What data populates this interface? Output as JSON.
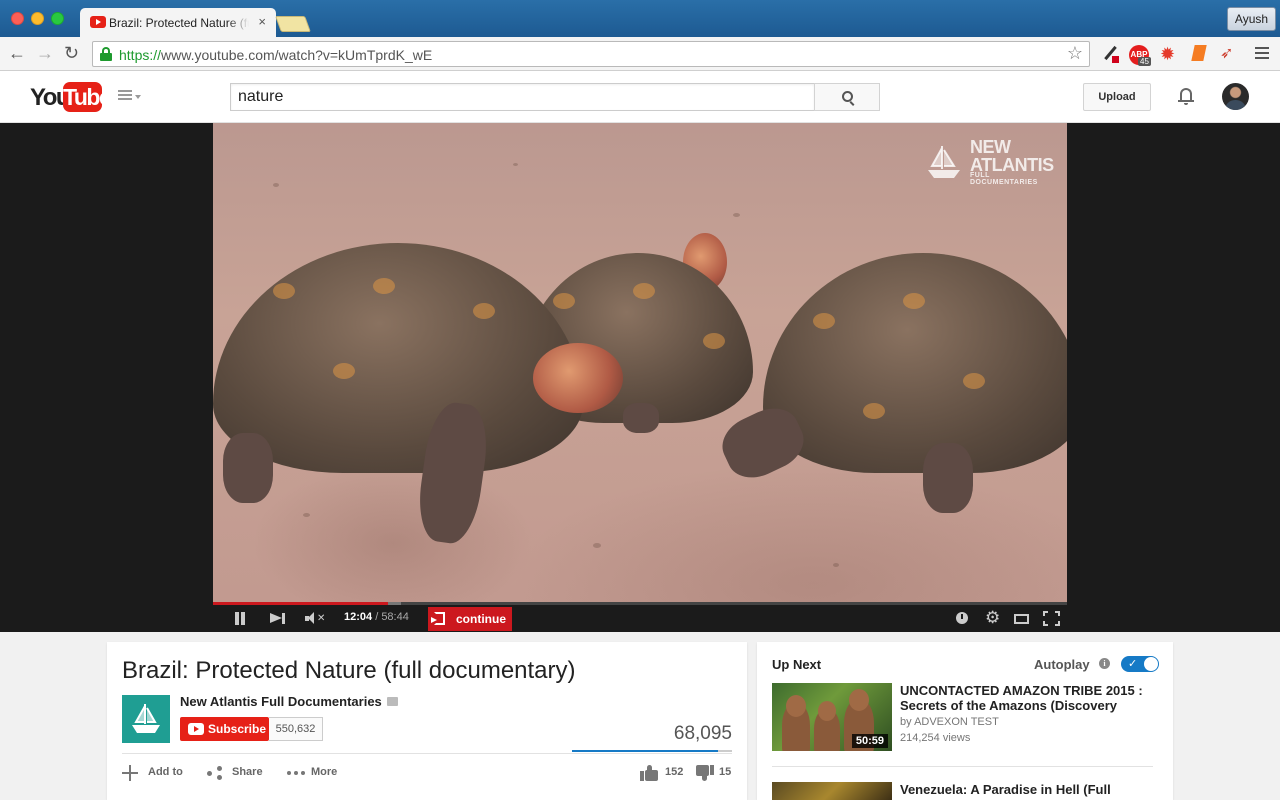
{
  "browser": {
    "tab_title": "Brazil: Protected Nature (full documentary)",
    "tab_close": "×",
    "profile_name": "Ayush",
    "url_scheme": "https://",
    "url_rest": "www.youtube.com/watch?v=kUmTprdK_wE",
    "abp_label": "ABP",
    "abp_badge": "45"
  },
  "header": {
    "logo_you": "You",
    "logo_tube": "Tube",
    "search_value": "nature",
    "upload_label": "Upload"
  },
  "player": {
    "watermark_title": "NEW ATLANTIS",
    "watermark_sub": "FULL DOCUMENTARIES",
    "current_time": "12:04",
    "time_separator": " / ",
    "duration": "58:44",
    "continue_label": "continue",
    "played_fraction": 0.205,
    "buffered_fraction": 0.22
  },
  "video": {
    "title": "Brazil: Protected Nature (full documentary)",
    "channel": "New Atlantis Full Documentaries",
    "subscribe_label": "Subscribe",
    "subscriber_count": "550,632",
    "view_count": "68,095",
    "like_fraction": 0.91,
    "actions": {
      "add_to": "Add to",
      "share": "Share",
      "more": "More"
    },
    "likes": "152",
    "dislikes": "15"
  },
  "up_next": {
    "heading": "Up Next",
    "autoplay_label": "Autoplay",
    "autoplay_on": true,
    "items": [
      {
        "title": "UNCONTACTED AMAZON TRIBE 2015 : Secrets of the Amazons (Discovery",
        "channel": "by ADVEXON TEST",
        "views": "214,254 views",
        "duration": "50:59"
      },
      {
        "title": "Venezuela: A Paradise in Hell (Full",
        "channel": "",
        "views": "",
        "duration": ""
      }
    ]
  }
}
